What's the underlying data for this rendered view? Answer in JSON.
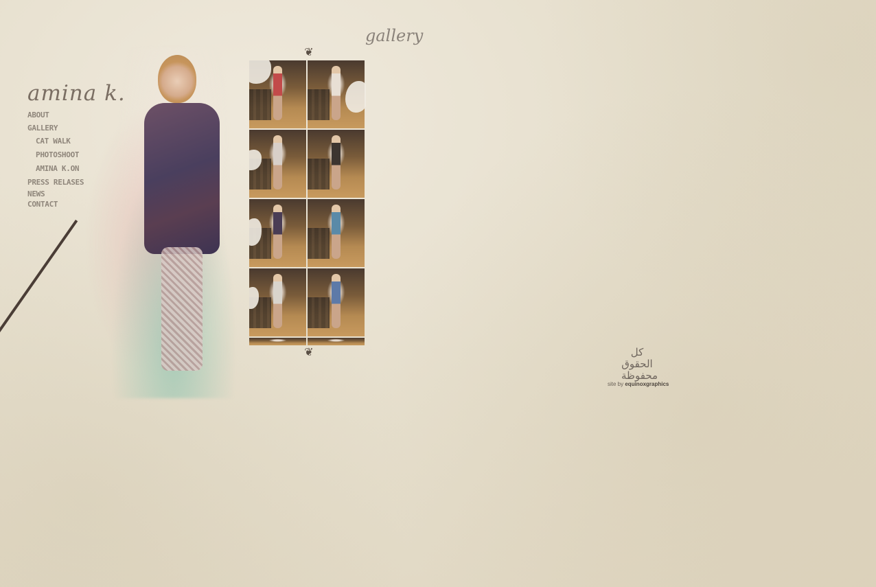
{
  "brand": {
    "logo_text": "amina k."
  },
  "nav": {
    "items": [
      {
        "label": "ABOUT",
        "level": "top"
      },
      {
        "label": "GALLERY",
        "level": "top"
      },
      {
        "label": "CAT WALK",
        "level": "sub"
      },
      {
        "label": "PHOTOSHOOT",
        "level": "sub"
      },
      {
        "label": "AMINA K.ON",
        "level": "sub"
      },
      {
        "label": "PRESS RELASES",
        "level": "top"
      },
      {
        "label": "NEWS",
        "level": "top"
      },
      {
        "label": "CONTACT",
        "level": "top"
      }
    ]
  },
  "gallery": {
    "title": "gallery",
    "ornament_top": "❦",
    "ornament_bottom": "❦",
    "thumbnails": [
      {
        "accent": "#c24a4a"
      },
      {
        "accent": "#e8dfd4"
      },
      {
        "accent": "#d8cfc8"
      },
      {
        "accent": "#3c3530"
      },
      {
        "accent": "#4a3d55"
      },
      {
        "accent": "#5a8aa8"
      },
      {
        "accent": "#d9d4cc"
      },
      {
        "accent": "#5d7aa8"
      }
    ]
  },
  "footer": {
    "arabic_mark": "كل الحقوق محفوظة",
    "credit_prefix": "site by",
    "credit_name": "equinoxgraphics"
  },
  "colors": {
    "background": "#e6dfcd",
    "nav_text": "#8f867b",
    "title_text": "#8a827a"
  }
}
